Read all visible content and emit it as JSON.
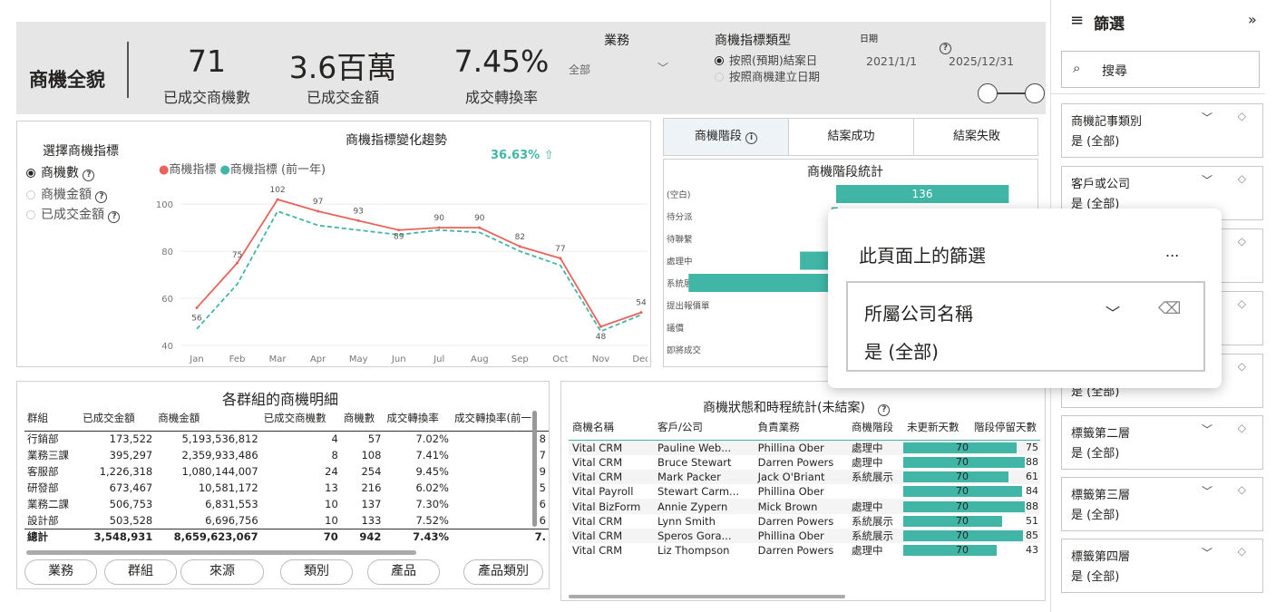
{
  "kpi": {
    "title": "商機全貌",
    "items": [
      {
        "value": "71",
        "label": "已成交商機數"
      },
      {
        "value": "3.6百萬",
        "label": "已成交金額"
      },
      {
        "value": "7.45%",
        "label": "成交轉換率"
      }
    ],
    "business_label": "業務",
    "business_value": "全部",
    "indicator_type_label": "商機指標類型",
    "indicator_options": [
      "按照(預期)結案日",
      "按照商機建立日期"
    ],
    "date_label": "日期",
    "date_start": "2021/1/1",
    "date_end": "2025/12/31"
  },
  "metric_selector": {
    "title": "選擇商機指標",
    "options": [
      "商機數",
      "商機金額",
      "已成交金額"
    ]
  },
  "trend_chart": {
    "title": "商機指標變化趨勢",
    "change": "36.63%",
    "change_arrow": "⇧",
    "legend": [
      "商機指標",
      "商機指標 (前一年)"
    ]
  },
  "chart_data": [
    {
      "type": "line",
      "title": "商機指標變化趨勢",
      "categories": [
        "Jan",
        "Feb",
        "Mar",
        "Apr",
        "May",
        "Jun",
        "Jul",
        "Aug",
        "Sep",
        "Oct",
        "Nov",
        "Dec"
      ],
      "series": [
        {
          "name": "商機指標",
          "values": [
            56,
            75,
            102,
            97,
            93,
            89,
            90,
            90,
            82,
            77,
            48,
            54
          ],
          "color": "#e8645a"
        },
        {
          "name": "商機指標 (前一年)",
          "values": [
            47,
            66,
            97,
            91,
            89,
            87,
            89,
            88,
            80,
            74,
            46,
            53
          ],
          "color": "#41b6a6"
        }
      ],
      "labels": [
        56,
        75,
        102,
        97,
        93,
        89,
        90,
        90,
        82,
        77,
        48,
        54
      ],
      "yticks": [
        40,
        60,
        80,
        100
      ],
      "ylim": [
        40,
        107
      ]
    },
    {
      "type": "bar",
      "title": "商機階段統計",
      "categories": [
        "(空白)",
        "待分派",
        "待聯繫",
        "處理中",
        "系統展示",
        "提出報價單",
        "議價",
        "即將成交"
      ],
      "values": [
        136,
        5,
        0,
        38,
        155,
        0,
        0,
        0
      ],
      "value_labels": [
        "136"
      ],
      "color": "#41b6a6"
    }
  ],
  "stage_tabs": [
    "商機階段",
    "結案成功",
    "結案失敗"
  ],
  "group_table": {
    "title": "各群組的商機明細",
    "columns": [
      "群組",
      "已成交金額",
      "商機金額",
      "已成交商機數",
      "商機數",
      "成交轉換率",
      "成交轉換率(前一"
    ],
    "rows": [
      [
        "行銷部",
        "173,522",
        "5,193,536,812",
        "4",
        "57",
        "7.02%",
        "8"
      ],
      [
        "業務三課",
        "395,297",
        "2,359,933,486",
        "8",
        "108",
        "7.41%",
        "7"
      ],
      [
        "客服部",
        "1,226,318",
        "1,080,144,007",
        "24",
        "254",
        "9.45%",
        "9"
      ],
      [
        "研發部",
        "673,467",
        "10,581,172",
        "13",
        "216",
        "6.02%",
        "5"
      ],
      [
        "業務二課",
        "506,753",
        "6,831,553",
        "10",
        "137",
        "7.30%",
        "6"
      ],
      [
        "設計部",
        "503,528",
        "6,696,756",
        "10",
        "133",
        "7.52%",
        "6"
      ]
    ],
    "total": [
      "總計",
      "3,548,931",
      "8,659,623,067",
      "70",
      "942",
      "7.43%",
      "7."
    ]
  },
  "drill_buttons": [
    "業務",
    "群組",
    "來源",
    "類別",
    "產品",
    "產品類別"
  ],
  "status_table": {
    "title": "商機狀態和時程統計(未結案)",
    "columns": [
      "商機名稱",
      "客戶/公司",
      "負責業務",
      "商機階段",
      "未更新天數",
      "階段停留天數"
    ],
    "rows": [
      [
        "Vital CRM",
        "Pauline Web...",
        "Phillina Ober",
        "處理中",
        70,
        75
      ],
      [
        "Vital CRM",
        "Bruce Stewart",
        "Darren Powers",
        "處理中",
        70,
        88
      ],
      [
        "Vital CRM",
        "Mark Packer",
        "Jack O'Briant",
        "系統展示",
        70,
        61
      ],
      [
        "Vital Payroll",
        "Stewart Carm...",
        "Phillina Ober",
        "",
        70,
        84
      ],
      [
        "Vital BizForm",
        "Annie Zypern",
        "Mick Brown",
        "處理中",
        70,
        88
      ],
      [
        "Vital CRM",
        "Lynn Smith",
        "Darren Powers",
        "系統展示",
        70,
        51
      ],
      [
        "Vital CRM",
        "Speros Gora...",
        "Phillina Ober",
        "系統展示",
        70,
        85
      ],
      [
        "Vital CRM",
        "Liz Thompson",
        "Darren Powers",
        "處理中",
        70,
        43
      ]
    ]
  },
  "filter_pane": {
    "title": "篩選",
    "collapse": "»",
    "search_placeholder": "搜尋",
    "cards": [
      {
        "title": "商機記事類別",
        "value": "是 (全部)"
      },
      {
        "title": "客戶或公司",
        "value": "是 (全部)"
      },
      {
        "title": "",
        "value": ""
      },
      {
        "title": "",
        "value": ""
      },
      {
        "title": "",
        "value": "是 (全部)"
      },
      {
        "title": "標籤第二層",
        "value": "是 (全部)"
      },
      {
        "title": "標籤第三層",
        "value": "是 (全部)"
      },
      {
        "title": "標籤第四層",
        "value": "是 (全部)"
      }
    ]
  },
  "page_filters_popup": {
    "title": "此頁面上的篩選",
    "more": "...",
    "filter_title": "所屬公司名稱",
    "filter_value": "是 (全部)"
  }
}
